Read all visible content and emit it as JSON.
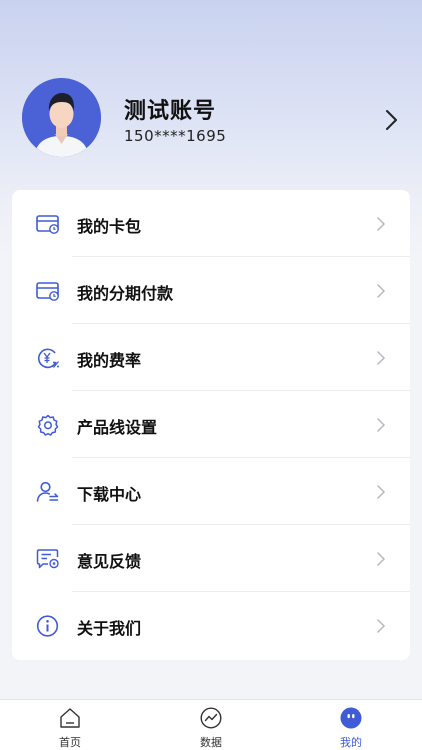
{
  "profile": {
    "name": "测试账号",
    "phone": "150****1695"
  },
  "menu": {
    "items": [
      {
        "label": "我的卡包",
        "icon": "card-icon"
      },
      {
        "label": "我的分期付款",
        "icon": "installment-card-icon"
      },
      {
        "label": "我的费率",
        "icon": "rate-icon"
      },
      {
        "label": "产品线设置",
        "icon": "gear-icon"
      },
      {
        "label": "下载中心",
        "icon": "download-user-icon"
      },
      {
        "label": "意见反馈",
        "icon": "feedback-icon"
      },
      {
        "label": "关于我们",
        "icon": "info-icon"
      }
    ]
  },
  "tabbar": {
    "tabs": [
      {
        "label": "首页",
        "icon": "home-icon"
      },
      {
        "label": "数据",
        "icon": "chart-icon"
      },
      {
        "label": "我的",
        "icon": "profile-face-icon",
        "active": true
      }
    ]
  },
  "colors": {
    "accent": "#3f5bd6",
    "avatar_bg": "#4a62d6",
    "text_primary": "#111111",
    "chevron": "#b5b7bf"
  }
}
